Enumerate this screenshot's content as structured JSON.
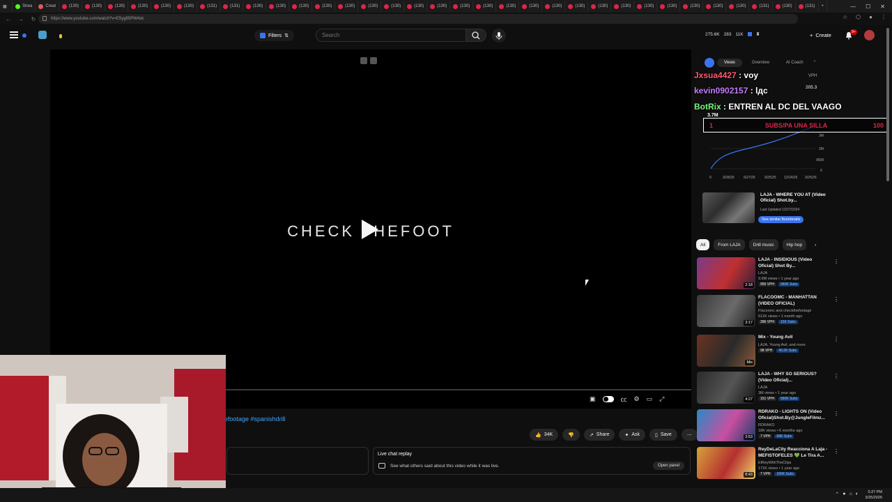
{
  "browser": {
    "tabs": [
      "Strea",
      "Creat",
      "(130)",
      "(130)",
      "(130)",
      "(130)",
      "(130)",
      "(130)",
      "(131)",
      "(131)",
      "(130)",
      "(130)",
      "(130)",
      "(130)",
      "(130)",
      "(130)",
      "(130)",
      "(130)",
      "(130)",
      "(130)",
      "(130)",
      "(130)",
      "(130)",
      "(130)",
      "(130)",
      "(130)",
      "(130)",
      "(130)",
      "(130)",
      "(130)",
      "(130)",
      "(130)",
      "(131)",
      "(130)",
      "(131)"
    ],
    "url": "https://www.youtube.com/watch?v=E5yg85PW4sk"
  },
  "header": {
    "filters_label": "Filters",
    "search_placeholder": "Search",
    "stats": [
      "275.6K",
      "283",
      "11K"
    ],
    "create_label": "Create",
    "notif_badge": "9+"
  },
  "player": {
    "brand_text": "CHECK THEFOOT"
  },
  "below": {
    "hashtags": "efootage #spanishdrill",
    "like_count": "34K",
    "share_label": "Share",
    "ask_label": "Ask",
    "save_label": "Save",
    "live_chat_title": "Live chat replay",
    "live_chat_desc": "See what others said about this video while it was live.",
    "open_panel": "Open panel"
  },
  "vidiq": {
    "tabs": [
      "Views",
      "Overview",
      "AI Coach"
    ],
    "vph_label": "VPH",
    "vph_value": "205.3",
    "total_views": "3.7M",
    "chart_y_ticks": [
      "3M",
      "2M",
      "950K",
      "0"
    ],
    "chart_x_ticks": [
      "0",
      "3/28/25",
      "6/27/25",
      "9/25/25",
      "12/24/25",
      "3/25/26"
    ],
    "suggest_title": "LAJA - WHERE YOU AT (Video Oficial) Shot.by...",
    "suggest_date": "Last Updated 12/27/2024",
    "suggest_button": "See similar thumbnails"
  },
  "chat": {
    "line1_user": "Jxsua4427",
    "line1_msg": ": voy",
    "line2_user": "kevin0902157",
    "line2_msg": ": lдc",
    "line3_user": "BotRix",
    "line3_msg": ": ENTREN AL DC DEL VAAGO",
    "subs_current": "1",
    "subs_label": "SUBS/PA UNA SILLA",
    "subs_goal": "100"
  },
  "chips": [
    "All",
    "From LAJA",
    "Drill music",
    "Hip hop"
  ],
  "recs": [
    {
      "title": "LAJA - INSIDIOUS (Video Oficial) Shot By...",
      "channel": "LAJA",
      "stats": "9.6M views • 1 year ago",
      "vph": "955 VPH",
      "subs": "580K Subs",
      "duration": "2:18",
      "colors": [
        "#7a3b8c",
        "#c03030",
        "#2d1f3b"
      ]
    },
    {
      "title": "FLACOOMC - MANHATTAN (VIDEO OFICIAL)",
      "channel": "Flacoomc and checkthefootage",
      "stats": "511K views • 1 month ago",
      "vph": "396 VPH",
      "subs": "15K Subs",
      "duration": "3:17",
      "colors": [
        "#3a3a3a",
        "#6a6a6a",
        "#1e1e1e"
      ]
    },
    {
      "title": "Mix - Young Avil",
      "channel": "LAJA, Young Avil, and more",
      "stats": "",
      "vph": "98 VPH",
      "subs": "40.2K Subs",
      "duration": "Mix",
      "colors": [
        "#6b3322",
        "#2a2a2a",
        "#8a5a3a"
      ]
    },
    {
      "title": "LAJA - WHY SO SERIOUS? (Video Oficial)...",
      "channel": "LAJA",
      "stats": "3M views • 1 year ago",
      "vph": "151 VPH",
      "subs": "580K Subs",
      "duration": "4:27",
      "colors": [
        "#2b2b2b",
        "#555",
        "#141414"
      ]
    },
    {
      "title": "RDRAKO - LIGHTS ON (Video Oficial)Shot.By@JungleFilmz...",
      "channel": "RDRAKO",
      "stats": "18K views • 6 months ago",
      "vph": "7 VPH",
      "subs": "68K Subs",
      "duration": "3:53",
      "colors": [
        "#2a8ac4",
        "#c94fa0",
        "#1b3c6a"
      ]
    },
    {
      "title": "ReyDeLaCity Reacciona A Laja - MEFISTOFELES 💚 Le Tira A...",
      "channel": "ElReyWithTheClips",
      "stats": "171K views • 1 year ago",
      "vph": "7 VPH",
      "subs": "165K Subs",
      "duration": "8:43",
      "colors": [
        "#d6a23a",
        "#b43030",
        "#f1d36a"
      ]
    }
  ],
  "taskbar": {
    "time": "5:27 PM",
    "date": "3/25/2026"
  },
  "colors": {
    "accent": "#3ea6ff",
    "vidiq_blue": "#3a74f0",
    "youtube_red": "#cc0000",
    "chat_red": "#e0244a"
  }
}
